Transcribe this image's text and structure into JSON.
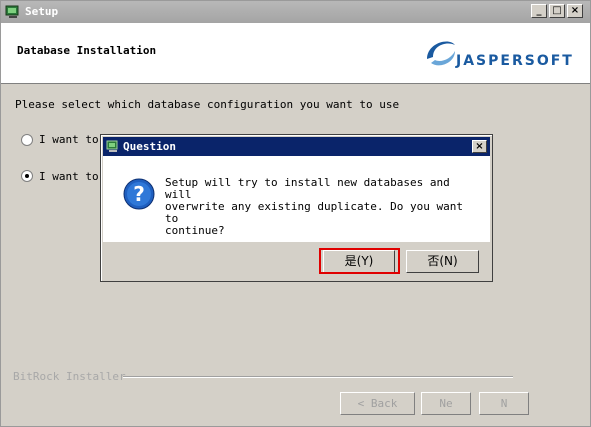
{
  "window": {
    "title": "Setup",
    "minimize_label": "_",
    "maximize_label": "□",
    "close_label": "×"
  },
  "header": {
    "title": "Database Installation",
    "logo_text": "JASPERSOFT"
  },
  "main": {
    "prompt": "Please select which database configuration you want to use",
    "options": [
      {
        "label": "I want to",
        "checked": false
      },
      {
        "label": "I want to",
        "checked": true
      }
    ]
  },
  "footer": {
    "brand": "BitRock Installer",
    "back_label": "< Back",
    "next_label": "Ne",
    "third_label": "N"
  },
  "dialog": {
    "title": "Question",
    "close_label": "×",
    "message": "Setup will try to install new databases and will\noverwrite any existing duplicate. Do you want to\ncontinue?",
    "yes_label": "是(Y)",
    "no_label": "否(N)"
  },
  "colors": {
    "dialog_titlebar": "#0a246a",
    "highlight": "#e00000",
    "logo_blue": "#1a5aa0"
  }
}
